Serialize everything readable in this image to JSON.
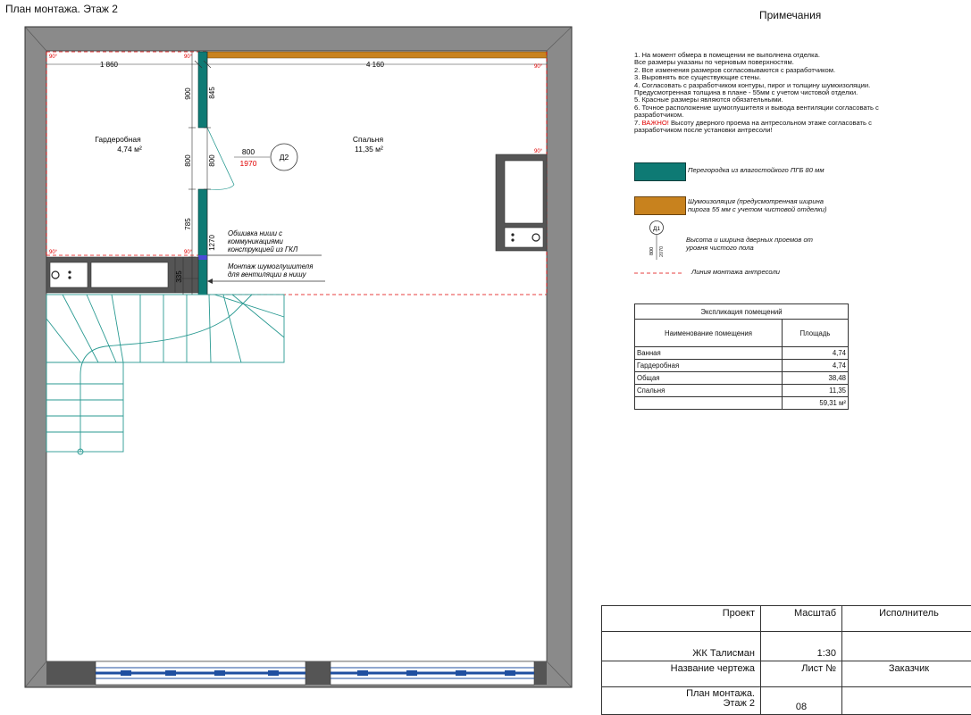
{
  "title": "План монтажа. Этаж 2",
  "plan": {
    "rooms": [
      {
        "name": "Гардеробная",
        "area": "4,74 м²"
      },
      {
        "name": "Спальня",
        "area": "11,35 м²"
      }
    ],
    "dims": {
      "top_left": "1 860",
      "top_right": "4 160",
      "v900": "900",
      "v845": "845",
      "v800a": "800",
      "v800b": "800",
      "v785": "785",
      "v1270": "1270",
      "v335": "335",
      "door_w": "800",
      "door_h": "1970",
      "door_tag": "Д2"
    },
    "angles": [
      "90°",
      "90°",
      "90°",
      "90°",
      "90°",
      "90°"
    ],
    "callouts": {
      "niche": [
        "Обшивка ниши с",
        "коммуникациями",
        "конструкцией из ГКЛ"
      ],
      "silencer": [
        "Монтаж шумоглушителя",
        "для вентиляции в нишу"
      ]
    }
  },
  "notes": {
    "title": "Примечания",
    "lines": [
      "1. На момент обмера в помещении не выполнена отделка.",
      "Все размеры указаны по черновым поверхностям.",
      "2. Все изменения размеров согласовываются с разработчиком.",
      "3. Выровнять все существующие стены.",
      "4. Согласовать с разработчиком контуры, пирог и толщину шумоизоляции.",
      "Предусмотренная толщина в плане - 55мм с учетом чистовой отделки.",
      "5. Красные размеры являются обязательными.",
      "6. Точное расположение шумоглушителя и вывода вентиляции согласовать с",
      "разработчиком."
    ],
    "line7_prefix": "7. ",
    "line7_warn": "ВАЖНО!",
    "line7_rest": " Высоту дверного проема на антресольном этаже согласовать с",
    "line8": "разработчиком после установки антресоли!"
  },
  "legend": {
    "partition": "Перегородка из влагостойкого ПГБ 80 мм",
    "insulation_1": "Шумоизоляция (предусмотренная ширина",
    "insulation_2": "пирога 55 мм с учетом чистовой отделки)",
    "door_1": "Высота и ширина дверных проемов от",
    "door_2": "уровня чистого пола",
    "door_tag": "Д1",
    "door_w": "800",
    "door_h": "2070",
    "mezzanine": "Линия монтажа антресоли"
  },
  "explication": {
    "title": "Экспликация помещений",
    "col_name": "Наименование помещения",
    "col_area": "Площадь",
    "rows": [
      {
        "name": "Ванная",
        "area": "4,74"
      },
      {
        "name": "Гардеробная",
        "area": "4,74"
      },
      {
        "name": "Общая",
        "area": "38,48"
      },
      {
        "name": "Спальня",
        "area": "11,35"
      }
    ],
    "total": "59,31 м²"
  },
  "stamp": {
    "project_label": "Проект",
    "scale_label": "Масштаб",
    "executor_label": "Исполнитель",
    "project_value": "ЖК Талисман",
    "scale_value": "1:30",
    "drawing_label": "Название чертежа",
    "sheet_label": "Лист №",
    "customer_label": "Заказчик",
    "drawing_value_1": "План монтажа.",
    "drawing_value_2": "Этаж 2",
    "sheet_value": "08"
  },
  "colors": {
    "wall": "#8a8a8a",
    "partition": "#0e7a74",
    "insulation": "#c8821e",
    "stair": "#2a9a92",
    "red": "#e00000",
    "window": "#1f4fa0"
  }
}
